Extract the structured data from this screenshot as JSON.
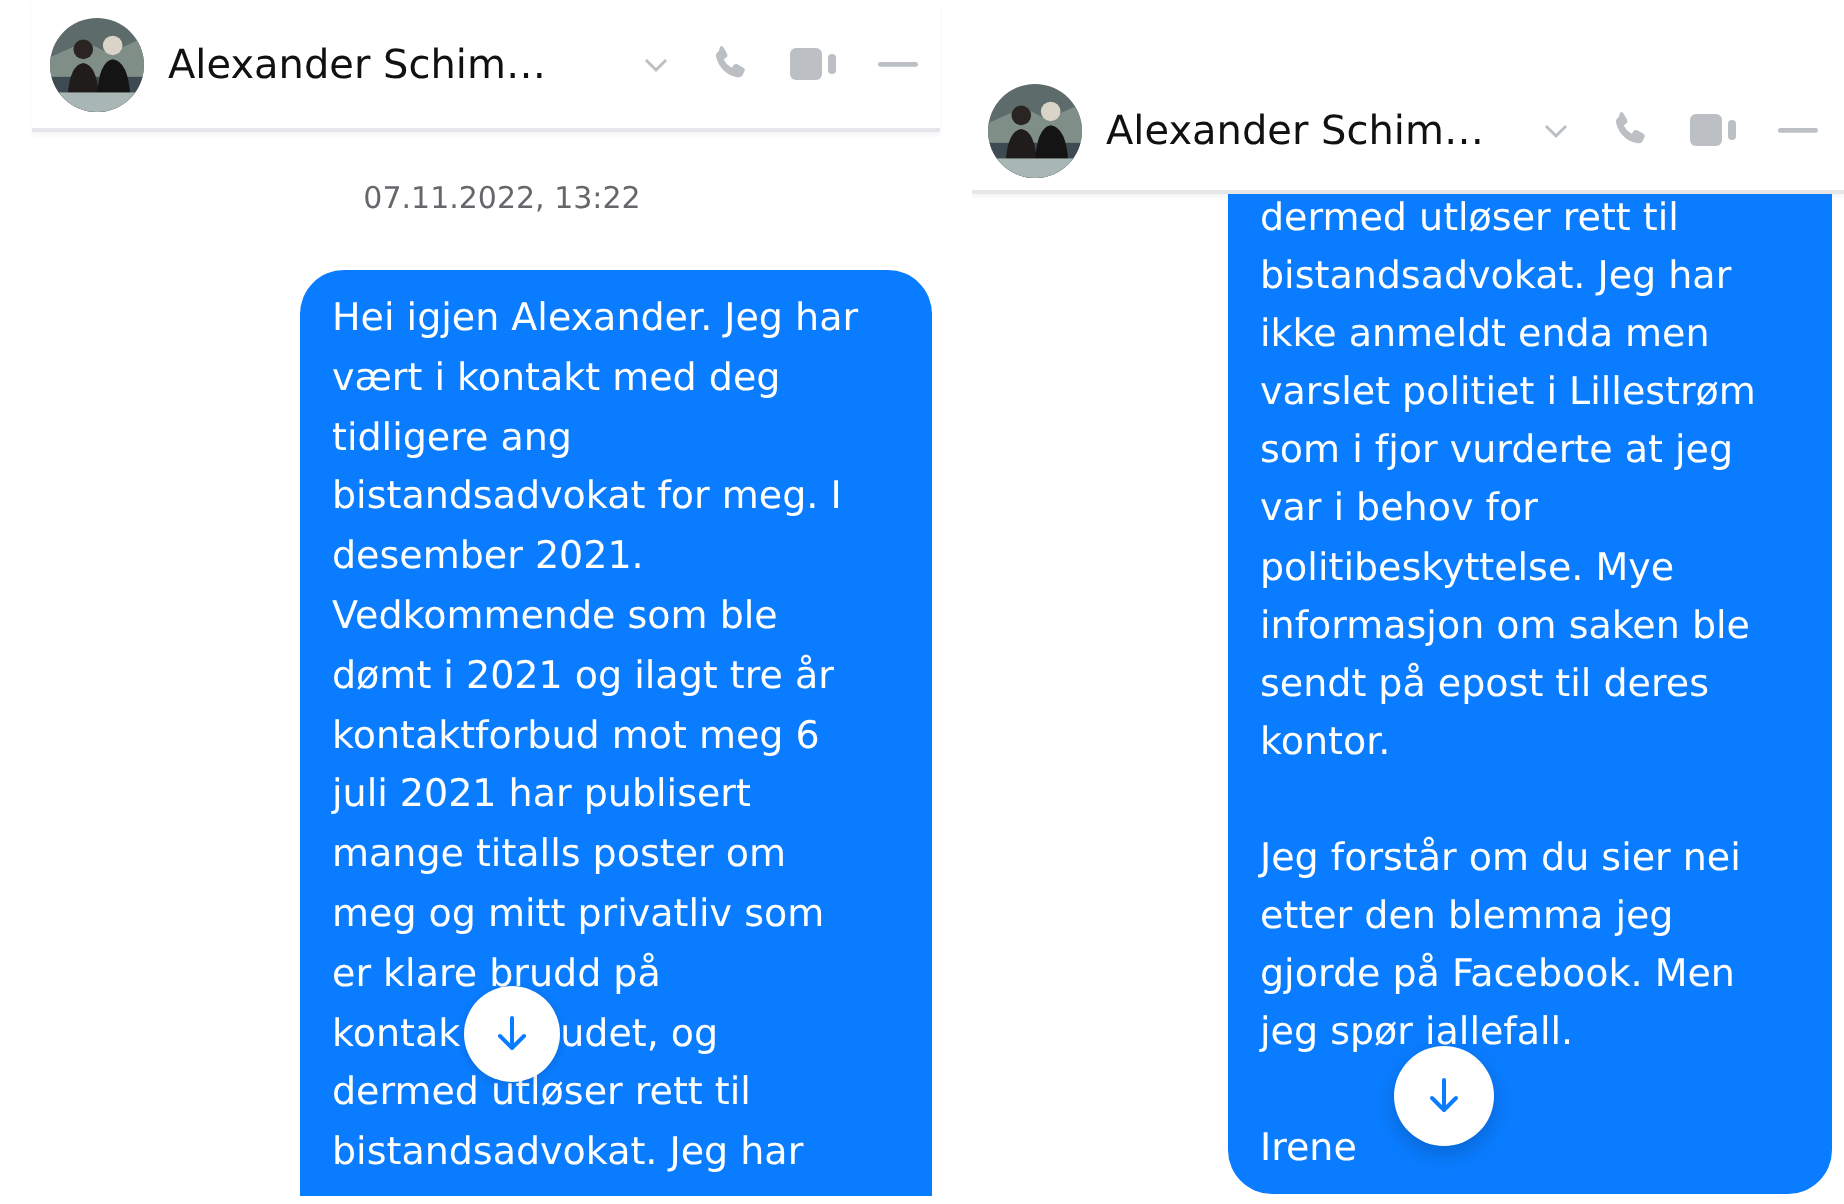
{
  "panels": [
    {
      "header": {
        "contact_name": "Alexander Schim…"
      },
      "timestamp": "07.11.2022, 13:22",
      "message": {
        "paragraphs": [
          [
            [
              "Hei igjen Alexander. Jeg har"
            ],
            [
              "vært i kontakt med deg"
            ],
            [
              "tidligere ang"
            ],
            [
              "bistandsadvokat for meg. I"
            ],
            [
              "desember 2021."
            ],
            [
              "Vedkommende som ble"
            ],
            [
              "dømt i 2021 og ilagt tre år"
            ],
            [
              "kontaktforbud mot meg 6"
            ],
            [
              "juli 2021 har publisert"
            ],
            [
              "mange titalls poster om"
            ],
            [
              "meg og mitt privatliv som"
            ],
            [
              "er klare brudd på"
            ],
            [
              "kontak",
              "udet, og"
            ],
            [
              "dermed utløser rett til"
            ],
            [
              "bistandsadvokat. Jeg har"
            ]
          ]
        ]
      }
    },
    {
      "header": {
        "contact_name": "Alexander Schim…"
      },
      "message": {
        "paragraphs": [
          [
            [
              "dermed utløser rett til"
            ],
            [
              "bistandsadvokat. Jeg har"
            ],
            [
              "ikke anmeldt enda men"
            ],
            [
              "varslet politiet i Lillestrøm"
            ],
            [
              "som i fjor vurderte at jeg"
            ],
            [
              "var i behov for"
            ],
            [
              "politibeskyttelse. Mye"
            ],
            [
              "informasjon om saken ble"
            ],
            [
              "sendt på epost til deres"
            ],
            [
              "kontor."
            ]
          ],
          [
            [
              "Jeg forstår om du sier nei"
            ],
            [
              "etter den blemma jeg"
            ],
            [
              "gjorde på Facebook. Men"
            ],
            [
              "jeg spør iallefall."
            ]
          ],
          [
            [
              "Irene"
            ]
          ]
        ]
      }
    }
  ]
}
